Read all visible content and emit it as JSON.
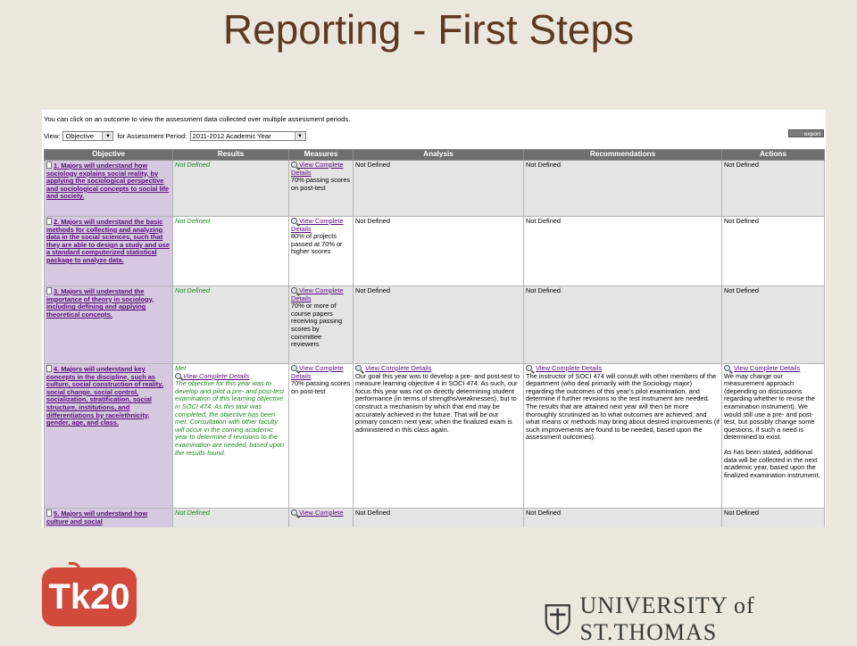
{
  "slide": {
    "title": "Reporting - First Steps"
  },
  "screen": {
    "intro": "You can click on an outcome to view the assessment data collected over multiple assessment periods.",
    "view_label": "View:",
    "view_value": "Objective",
    "period_label": "for Assessment Period:",
    "period_value": "2011-2012 Academic Year",
    "export_label": "export",
    "columns": [
      "Objective",
      "Results",
      "Measures",
      "Analysis",
      "Recommendations",
      "Actions"
    ],
    "rows": [
      {
        "objective": "1. Majors will understand how sociology explains social reality, by applying the sociological perspective and sociological concepts to social life and society.",
        "results": "Not Defined",
        "measure_link": "View Complete Details",
        "measure_text": "70% passing scores on post-test",
        "analysis": "Not Defined",
        "recommendations": "Not Defined",
        "actions": "Not Defined"
      },
      {
        "objective": "2. Majors will understand the basic methods for collecting and analyzing data in the social sciences, such that they are able to design a study and use a standard computerized statistical package to analyze data.",
        "results": "Not Defined",
        "measure_link": "View Complete Details",
        "measure_text": "80% of projects passed at 70% or higher scores",
        "analysis": "Not Defined",
        "recommendations": "Not Defined",
        "actions": "Not Defined"
      },
      {
        "objective": "3. Majors will understand the importance of theory in sociology, including defining and applying theoretical concepts.",
        "results": "Not Defined",
        "measure_link": "View Complete Details",
        "measure_text": "70% or more of course papers receiving passing scores by committee reviewers",
        "analysis": "Not Defined",
        "recommendations": "Not Defined",
        "actions": "Not Defined"
      },
      {
        "objective": "4. Majors will understand key concepts in the discipline, such as culture, social construction of reality, social change, social control, socialization, stratification, social structure, institutions, and differentiations by race/ethnicity, gender, age, and class.",
        "results_status": "Met",
        "results_link": "View Complete Details",
        "results_text": "The objective for this year was to develop and pilot a pre- and post-test examination of this learning objective in SOCI 474. As this task was completed, the objective has been met. Consultation with other faculty will occur in the coming academic year to determine if revisions to the examination are needed, based upon the results found.",
        "measure_link": "View Complete Details",
        "measure_text": "70% passing scores on post-test",
        "analysis_link": "View Complete Details",
        "analysis_text": "Our goal this year was to develop a pre- and post-test to measure learning objective 4 in SOCI 474. As such, our focus this year was not on directly determining student performance (in terms of strengths/weaknesses), but to construct a mechanism by which that end may be accurately achieved in the future. That will be our primary concern next year, when the finalized exam is administered in this class again.",
        "recommendations_link": "View Complete Details",
        "recommendations_text": "The instructor of SOCI 474 will consult with other members of the department (who deal primarily with the Sociology major) regarding the outcomes of this year's pilot examination, and determine if further revisions to the test instrument are needed. The results that are attained next year will then be more thoroughly scrutinized as to what outcomes are achieved, and what means or methods may bring about desired improvements (if such improvements are found to be needed, based upon the assessment outcomes).",
        "actions_link": "View Complete Details",
        "actions_text": "We may change our measurement approach (depending on discussions regarding whether to revise the examination instrument). We would still use a pre- and post-test, but possibly change some questions, if such a need is determined to exist.",
        "actions_text2": "As has been stated, additional data will be collected in the next academic year, based upon the finalized examination instrument."
      },
      {
        "objective": "5. Majors will understand how culture and social",
        "results": "Not Defined",
        "measure_link": "View Complete",
        "analysis": "Not Defined",
        "recommendations": "Not Defined",
        "actions": "Not Defined"
      }
    ]
  },
  "logos": {
    "tk20": "Tk20",
    "university": "UNIVERSITY of ST.THOMAS"
  },
  "colors": {
    "title": "#5e3a25",
    "objective_bg": "#d6c8e0",
    "link": "#5a0d7a",
    "met_green": "#1d8a1d",
    "tk20_red": "#d14a3c"
  }
}
